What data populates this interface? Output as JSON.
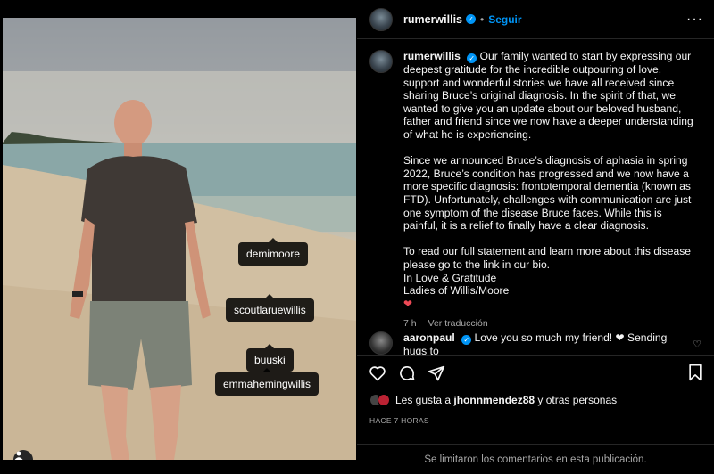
{
  "post": {
    "photo_tags": [
      "demimoore",
      "scoutlaruewillis",
      "buuski",
      "emmahemingwillis"
    ],
    "icons": {
      "user_tags": "person-icon",
      "more": "more-horizontal-icon",
      "verified": "verified-badge-icon",
      "like": "heart-icon",
      "comment": "comment-icon",
      "share": "paper-plane-icon",
      "save": "bookmark-icon"
    }
  },
  "header": {
    "username": "rumerwillis",
    "separator": "•",
    "follow_label": "Seguir",
    "more_label": "···"
  },
  "caption": {
    "username": "rumerwillis",
    "paragraphs": [
      "Our family wanted to start by expressing our deepest gratitude for the incredible outpouring of love, support and wonderful stories we have all received since sharing Bruce’s original diagnosis. In the spirit of that, we wanted to give you an update about our beloved husband, father and friend since we now have a deeper understanding of what he is experiencing.",
      "Since we announced Bruce’s diagnosis of aphasia in spring 2022, Bruce’s condition has progressed and we now have a more specific diagnosis: frontotemporal dementia (known as FTD). Unfortunately, challenges with communication are just one symptom of the disease Bruce faces. While this is painful, it is a relief to finally have a clear diagnosis."
    ],
    "closing_lines": [
      "To read our full statement and learn more about this disease please go to the link in our bio.",
      "In Love & Gratitude",
      "Ladies of Willis/Moore"
    ],
    "heart": "❤",
    "time": "7 h",
    "translate_label": "Ver traducción"
  },
  "comment": {
    "username": "aaronpaul",
    "text": "Love you so much my friend! ❤ Sending hugs to"
  },
  "likes": {
    "prefix": "Les gusta a",
    "user": "jhonnmendez88",
    "suffix": "y otras personas"
  },
  "timestamp": "HACE 7 HORAS",
  "footer_text": "Se limitaron los comentarios en esta publicación.",
  "colors": {
    "background": "#000000",
    "link_blue": "#0095f6",
    "heart_red": "#ed4956",
    "muted": "#a8a8a8"
  }
}
